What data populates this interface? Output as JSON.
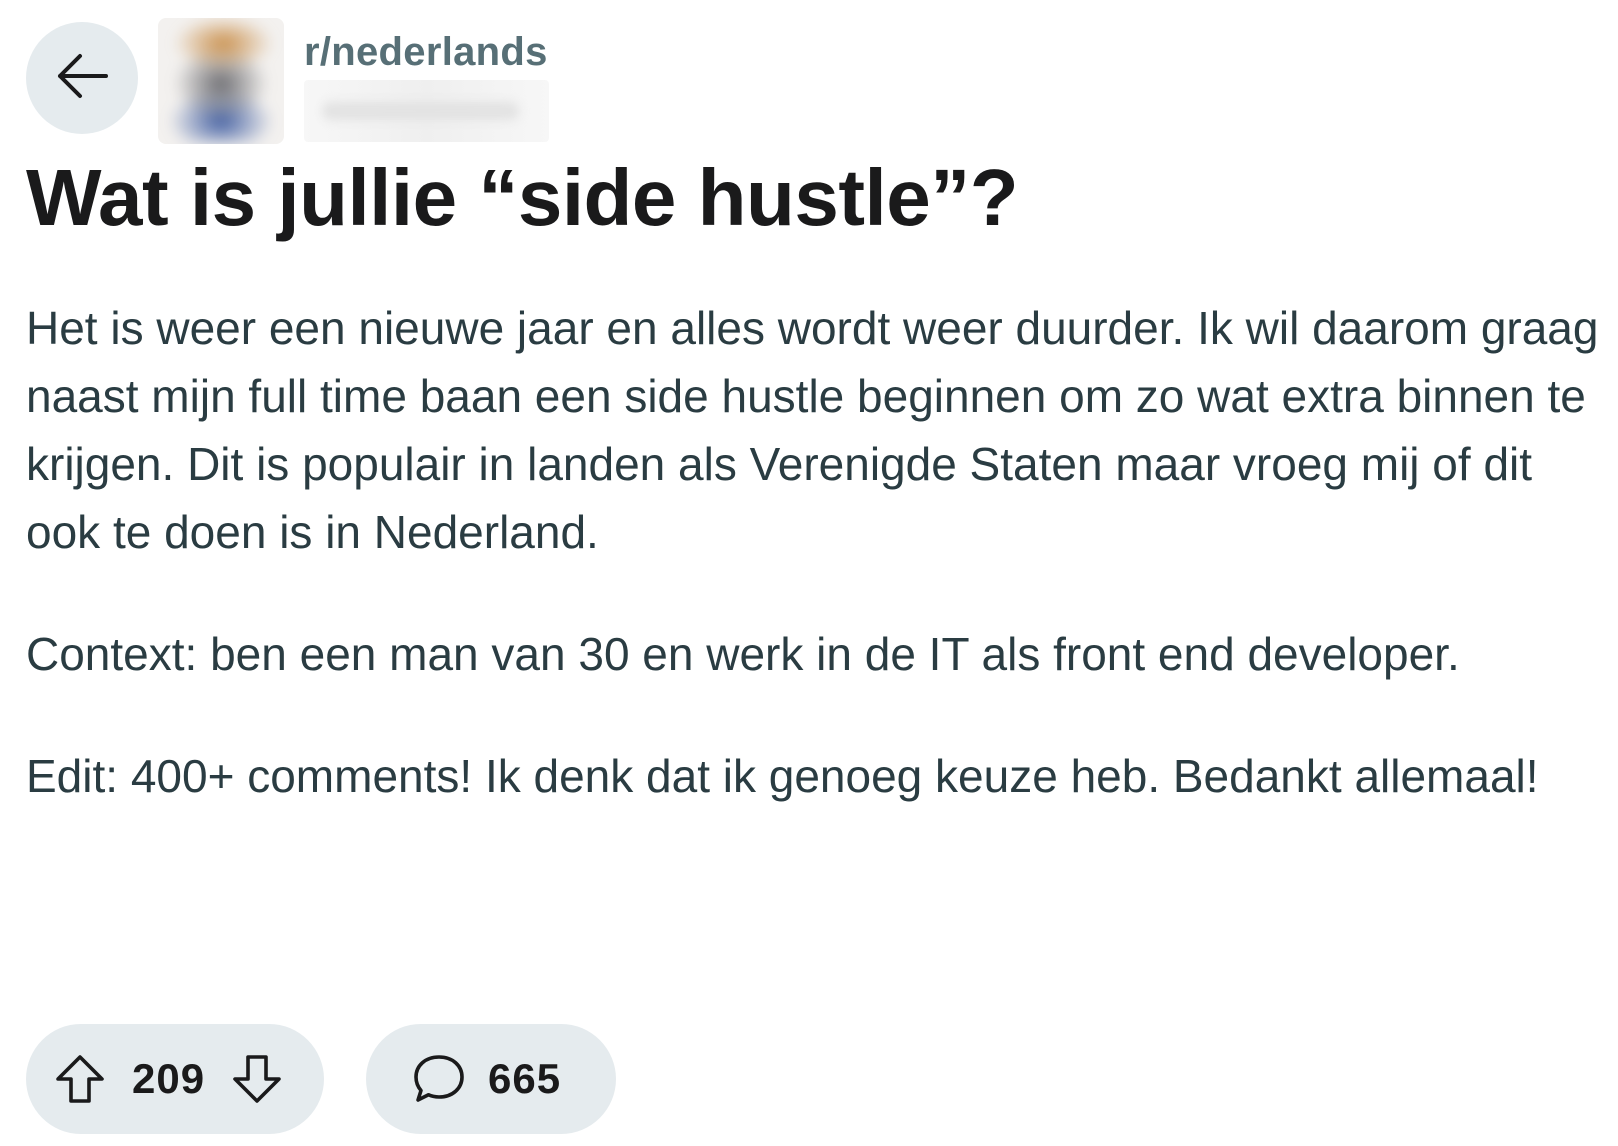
{
  "header": {
    "subreddit": "r/nederlands",
    "back_icon": "arrow-left-icon",
    "username_obscured": true
  },
  "post": {
    "title": "Wat is jullie “side hustle”?",
    "paragraphs": [
      "Het is weer een nieuwe jaar en alles wordt weer duurder. Ik wil daarom graag naast mijn full time baan een side hustle beginnen om zo wat extra binnen te krijgen. Dit is populair in landen als Verenigde Staten maar vroeg mij of dit ook te doen is in Nederland.",
      "Context: ben een man van 30 en werk in de IT als front end developer.",
      "Edit: 400+ comments! Ik denk dat ik genoeg keuze heb. Bedankt allemaal!"
    ]
  },
  "actions": {
    "vote_count": "209",
    "comment_count": "665",
    "upvote_icon": "arrow-up-icon",
    "downvote_icon": "arrow-down-icon",
    "comment_icon": "speech-bubble-icon"
  },
  "colors": {
    "pill_background": "#e5ebee",
    "subreddit_text": "#576f76",
    "body_text": "#2a3c42",
    "title_text": "#1a1a1b"
  }
}
